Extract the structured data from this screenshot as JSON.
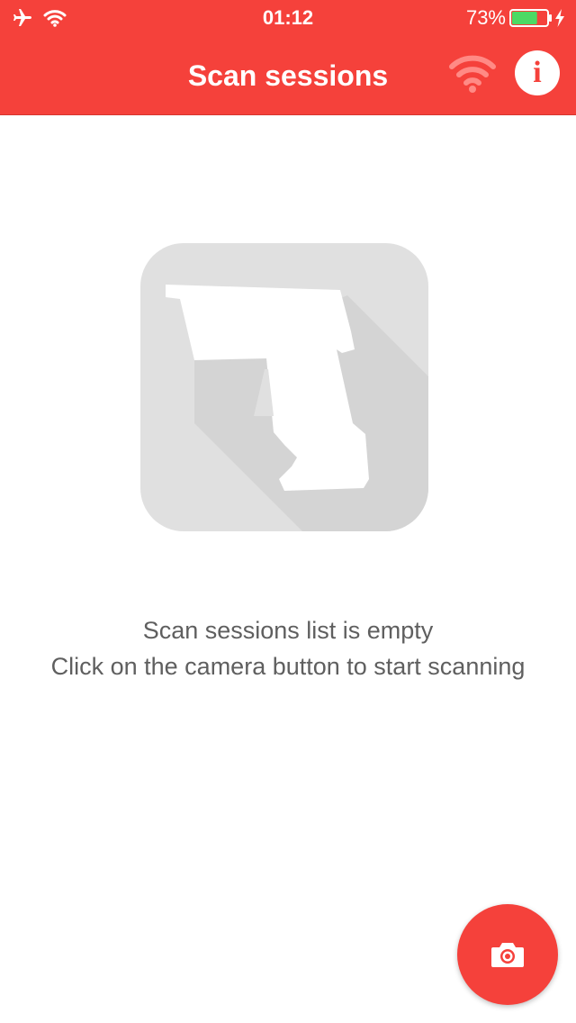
{
  "status_bar": {
    "time": "01:12",
    "battery_percent": "73%",
    "battery_level": 0.73,
    "icons": [
      "airplane-icon",
      "wifi-icon",
      "battery-icon",
      "charging-icon"
    ]
  },
  "nav": {
    "title": "Scan sessions",
    "icons": [
      "wifi-icon",
      "info-icon"
    ],
    "info_glyph": "i"
  },
  "empty_state": {
    "icon": "barcode-scanner-icon",
    "title": "Scan sessions list is empty",
    "subtitle": "Click on the camera button to start scanning"
  },
  "fab": {
    "icon": "camera-icon"
  },
  "colors": {
    "accent": "#f5413b",
    "illustration_bg": "#e0e0e0",
    "illustration_shadow": "#d3d3d3",
    "text": "#5f5f5f",
    "battery_fill": "#4cd964"
  }
}
